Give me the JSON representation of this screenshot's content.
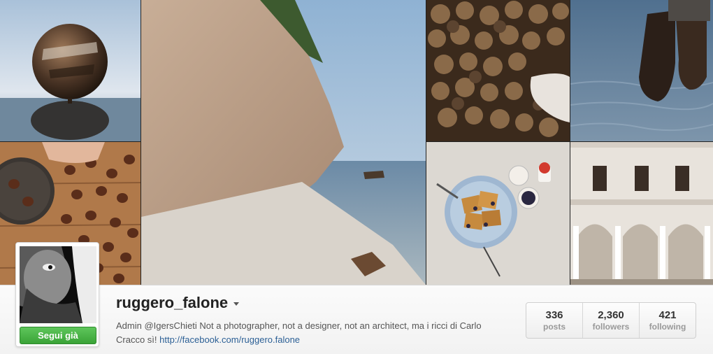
{
  "profile": {
    "username": "ruggero_falone",
    "follow_label": "Segui già",
    "bio_text": "Admin @IgersChieti Not a photographer, not a designer, not an architect, ma i ricci di Carlo Cracco sì! ",
    "bio_link": "http://facebook.com/ruggero.falone"
  },
  "stats": [
    {
      "value": "336",
      "label": "posts"
    },
    {
      "value": "2,360",
      "label": "followers"
    },
    {
      "value": "421",
      "label": "following"
    }
  ],
  "colors": {
    "follow_button": "#4cb749",
    "link": "#2b5f95"
  },
  "icons": {
    "menu_caret": "caret-down-icon"
  }
}
